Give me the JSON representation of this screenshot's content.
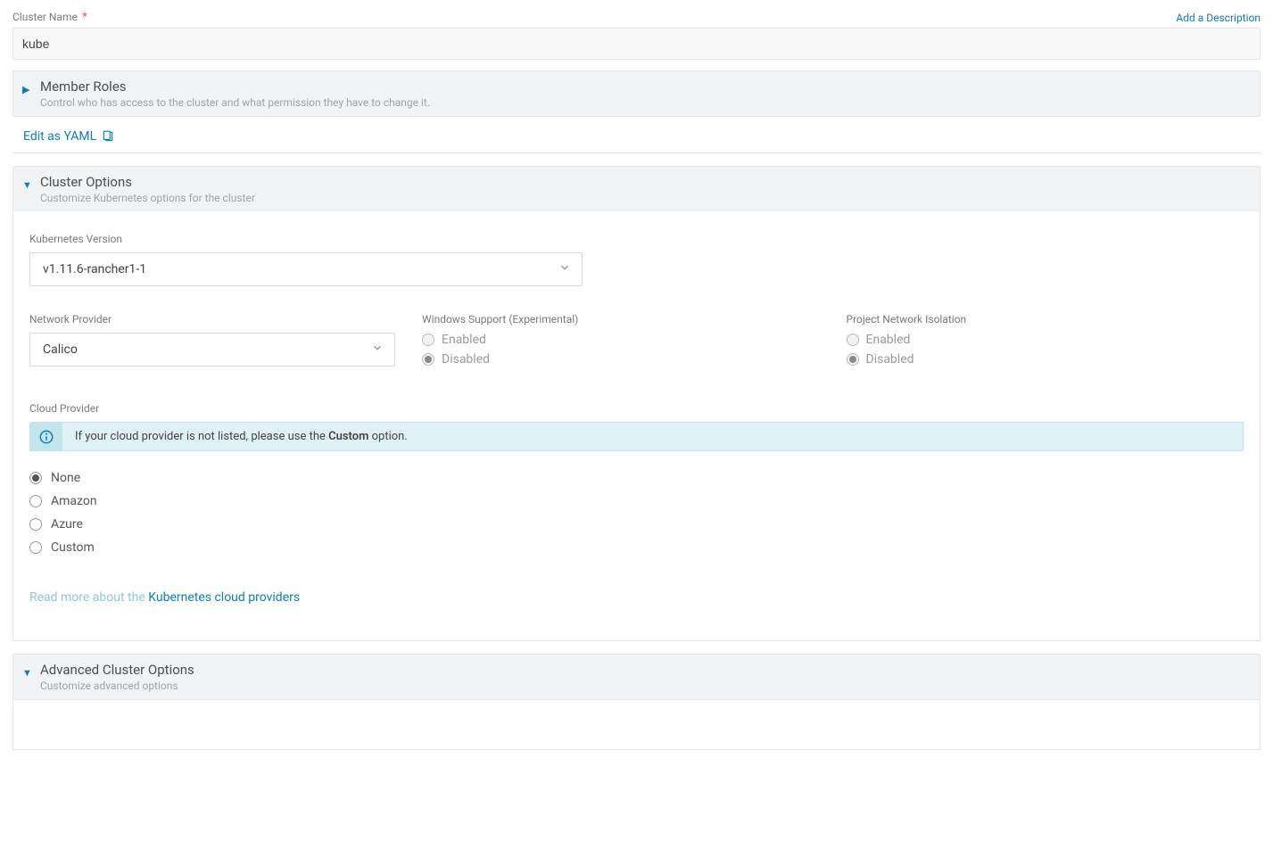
{
  "clusterName": {
    "label": "Cluster Name",
    "required": "*",
    "value": "kube"
  },
  "addDescription": "Add a Description",
  "memberRoles": {
    "title": "Member Roles",
    "subtitle": "Control who has access to the cluster and what permission they have to change it."
  },
  "editYaml": "Edit as YAML",
  "clusterOptions": {
    "title": "Cluster Options",
    "subtitle": "Customize Kubernetes options for the cluster"
  },
  "kubeVersion": {
    "label": "Kubernetes Version",
    "value": "v1.11.6-rancher1-1"
  },
  "networkProvider": {
    "label": "Network Provider",
    "value": "Calico"
  },
  "windowsSupport": {
    "label": "Windows Support (Experimental)",
    "enabled": "Enabled",
    "disabled": "Disabled"
  },
  "projectIsolation": {
    "label": "Project Network Isolation",
    "enabled": "Enabled",
    "disabled": "Disabled"
  },
  "cloudProvider": {
    "label": "Cloud Provider",
    "bannerPrefix": "If your cloud provider is not listed, please use the ",
    "bannerBold": "Custom",
    "bannerSuffix": " option.",
    "none": "None",
    "amazon": "Amazon",
    "azure": "Azure",
    "custom": "Custom"
  },
  "readMore": {
    "pre": "Read more about the ",
    "post": "Kubernetes cloud providers"
  },
  "advanced": {
    "title": "Advanced Cluster Options",
    "subtitle": "Customize advanced options"
  }
}
